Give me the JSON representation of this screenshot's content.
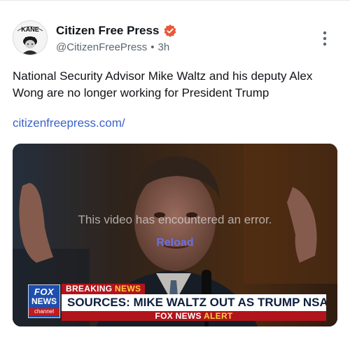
{
  "post": {
    "display_name": "Citizen Free Press",
    "handle": "@CitizenFreePress",
    "separator": "•",
    "time_ago": "3h",
    "text": "National Security Advisor Mike Waltz and his deputy Alex Wong are no longer working for President Trump",
    "link": "citizenfreepress.com/",
    "avatar_label": "KANE"
  },
  "media": {
    "error_message": "This video has encountered an error.",
    "reload_label": "Reload",
    "chyron": {
      "logo_top": "FOX",
      "logo_bottom": "NEWS",
      "logo_sub": "channel",
      "breaking_1": "BREAKING",
      "breaking_2": "NEWS",
      "headline": "SOURCES: MIKE WALTZ OUT AS TRUMP NSA",
      "alert_1": "FOX NEWS",
      "alert_2": "ALERT"
    }
  },
  "colors": {
    "verified_badge": "#e8573a",
    "link": "#3a63c8",
    "reload": "#6e6fe0"
  },
  "icons": {
    "verified": "verified-badge-icon",
    "more": "more-vertical-icon"
  }
}
